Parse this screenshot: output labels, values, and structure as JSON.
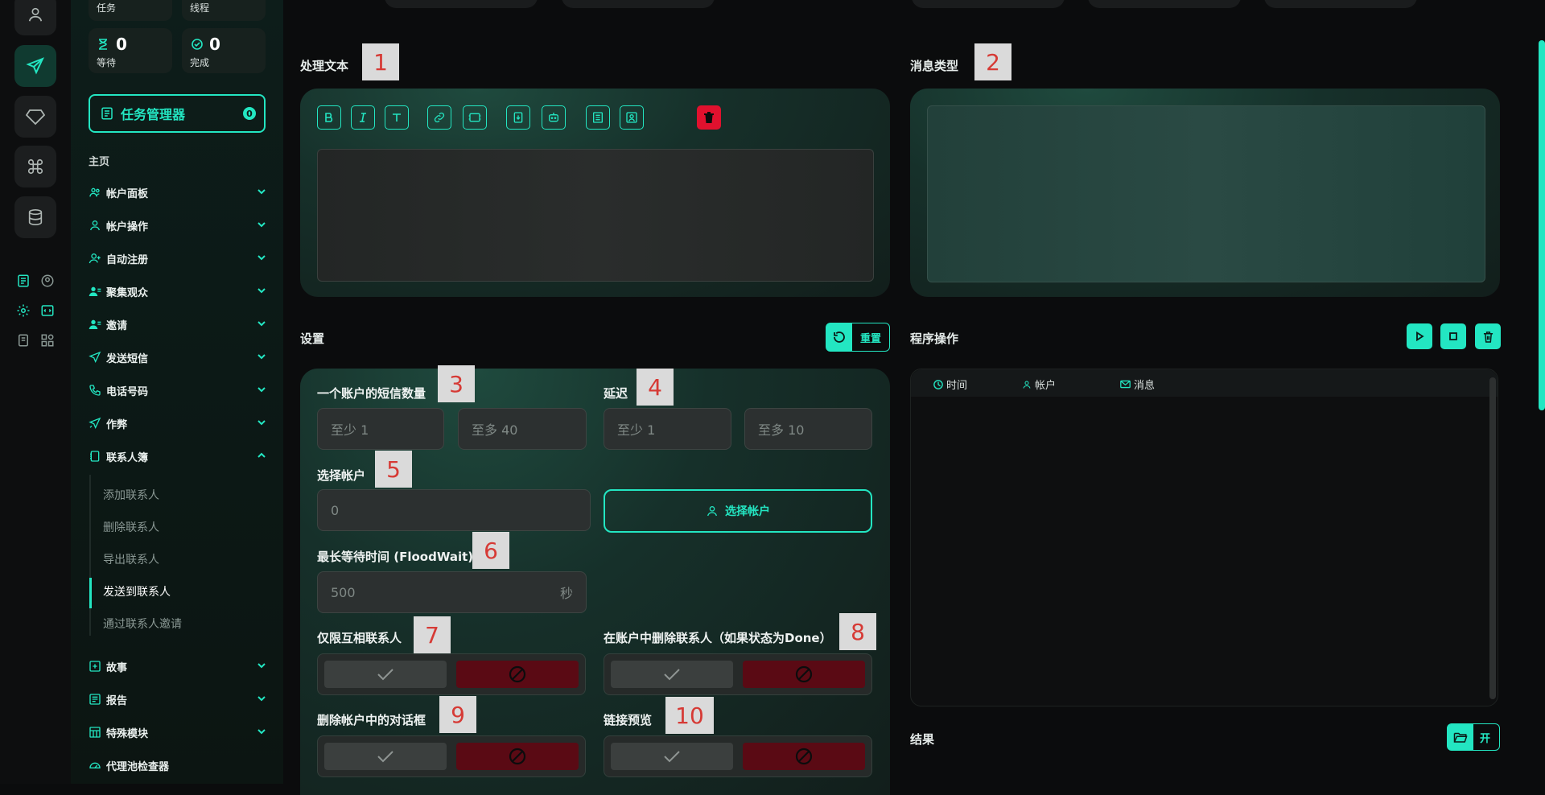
{
  "sidebar": {
    "top_labels": [
      "任务",
      "线程"
    ],
    "stats": [
      {
        "value": "0",
        "label": "等待"
      },
      {
        "value": "0",
        "label": "完成"
      }
    ],
    "task_manager": {
      "label": "任务管理器",
      "badge": "0"
    },
    "home_label": "主页",
    "nav": [
      {
        "label": "帐户面板"
      },
      {
        "label": "帐户操作"
      },
      {
        "label": "自动注册"
      },
      {
        "label": "聚集观众"
      },
      {
        "label": "邀请"
      },
      {
        "label": "发送短信"
      },
      {
        "label": "电话号码"
      },
      {
        "label": "作弊"
      },
      {
        "label": "联系人簿"
      }
    ],
    "contacts_sub": [
      "添加联系人",
      "删除联系人",
      "导出联系人",
      "发送到联系人",
      "通过联系人邀请"
    ],
    "nav_bottom": [
      {
        "label": "故事"
      },
      {
        "label": "报告"
      },
      {
        "label": "特殊模块"
      },
      {
        "label": "代理池检查器"
      }
    ]
  },
  "main": {
    "process_text": {
      "title": "处理文本",
      "marker": "1"
    },
    "message_type": {
      "title": "消息类型",
      "marker": "2"
    },
    "settings": {
      "title": "设置",
      "reset_label": "重置",
      "sms_per_account": {
        "label": "一个账户的短信数量",
        "marker": "3",
        "min_placeholder": "至少  1",
        "max_placeholder": "至多  40"
      },
      "delay": {
        "label": "延迟",
        "marker": "4",
        "min_placeholder": "至少  1",
        "max_placeholder": "至多  10"
      },
      "select_account": {
        "label": "选择帐户",
        "marker": "5",
        "value": "0",
        "button": "选择帐户"
      },
      "flood_wait": {
        "label": "最长等待时间 (FloodWait)",
        "marker": "6",
        "placeholder": "500",
        "unit": "秒"
      },
      "mutual_only": {
        "label": "仅限互相联系人",
        "marker": "7"
      },
      "delete_contacts": {
        "label": "在账户中删除联系人（如果状态为Done）",
        "marker": "8"
      },
      "delete_dialogs": {
        "label": "删除帐户中的对话框",
        "marker": "9"
      },
      "link_preview": {
        "label": "链接预览",
        "marker": "10"
      }
    },
    "program_ops": {
      "title": "程序操作",
      "columns": [
        "时间",
        "帐户",
        "消息"
      ]
    },
    "result": {
      "title": "结果",
      "open_label": "开"
    }
  },
  "colors": {
    "accent": "#23e6c2",
    "danger": "#e0112e",
    "danger_dark": "#5a0a14"
  }
}
